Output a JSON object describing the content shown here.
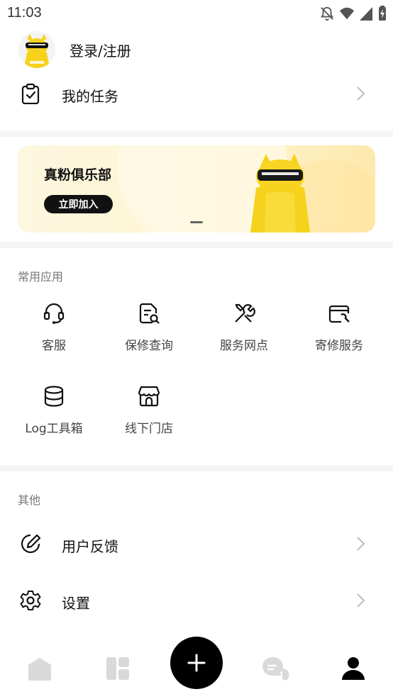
{
  "status_bar": {
    "time": "11:03",
    "icons": [
      "notifications-off-icon",
      "wifi-icon",
      "signal-icon",
      "battery-charging-icon"
    ]
  },
  "profile": {
    "login_label": "登录/注册",
    "avatar_icon": "cat-mascot-avatar"
  },
  "tasks": {
    "label": "我的任务",
    "icon": "clipboard-check-icon"
  },
  "banner": {
    "title": "真粉俱乐部",
    "button_label": "立即加入",
    "mascot_icon": "cat-mascot-illustration"
  },
  "apps": {
    "title": "常用应用",
    "items": [
      {
        "label": "客服",
        "icon": "headset-icon"
      },
      {
        "label": "保修查询",
        "icon": "document-search-icon"
      },
      {
        "label": "服务网点",
        "icon": "tools-icon"
      },
      {
        "label": "寄修服务",
        "icon": "box-wrench-icon"
      },
      {
        "label": "Log工具箱",
        "icon": "database-icon"
      },
      {
        "label": "线下门店",
        "icon": "store-icon"
      }
    ]
  },
  "others": {
    "title": "其他",
    "items": [
      {
        "label": "用户反馈",
        "icon": "edit-icon"
      },
      {
        "label": "设置",
        "icon": "gear-icon"
      }
    ]
  },
  "tab_bar": {
    "tabs": [
      "home-tab-icon",
      "dashboard-tab-icon",
      "add-icon",
      "chat-tab-icon",
      "profile-tab-icon"
    ],
    "active": "profile-tab-icon"
  },
  "colors": {
    "accent": "#000000",
    "banner_gradient_start": "#fdf7df",
    "banner_gradient_end": "#fde9ad",
    "mascot_yellow": "#f6d21c"
  }
}
